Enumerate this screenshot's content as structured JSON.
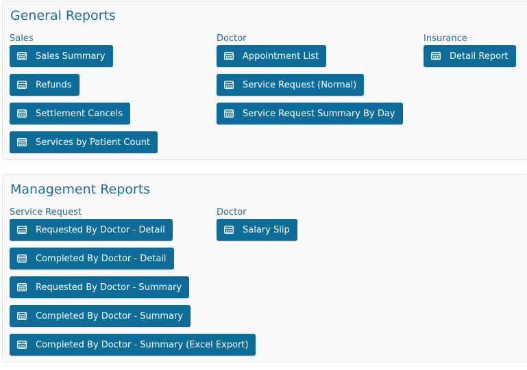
{
  "general": {
    "title": "General Reports",
    "columns": [
      {
        "label": "Sales",
        "buttons": [
          "Sales Summary",
          "Refunds",
          "Settlement Cancels",
          "Services by Patient Count"
        ]
      },
      {
        "label": "Doctor",
        "buttons": [
          "Appointment List",
          "Service Request (Normal)",
          "Service Request Summary By Day"
        ]
      },
      {
        "label": "Insurance",
        "buttons": [
          "Detail Report"
        ]
      }
    ]
  },
  "management": {
    "title": "Management Reports",
    "columns": [
      {
        "label": "Service Request",
        "buttons": [
          "Requested By Doctor - Detail",
          "Completed By Doctor - Detail",
          "Requested By Doctor - Summary",
          "Completed By Doctor - Summary",
          "Completed By Doctor - Summary (Excel Export)"
        ]
      },
      {
        "label": "Doctor",
        "buttons": [
          "Salary Slip"
        ]
      }
    ]
  },
  "theme": {
    "accent": "#1e6f9f",
    "button_bg": "#0e6c98",
    "button_text": "#ffffff",
    "card_bg": "#f9f9fb"
  },
  "icons": {
    "report_button": "report-icon"
  }
}
